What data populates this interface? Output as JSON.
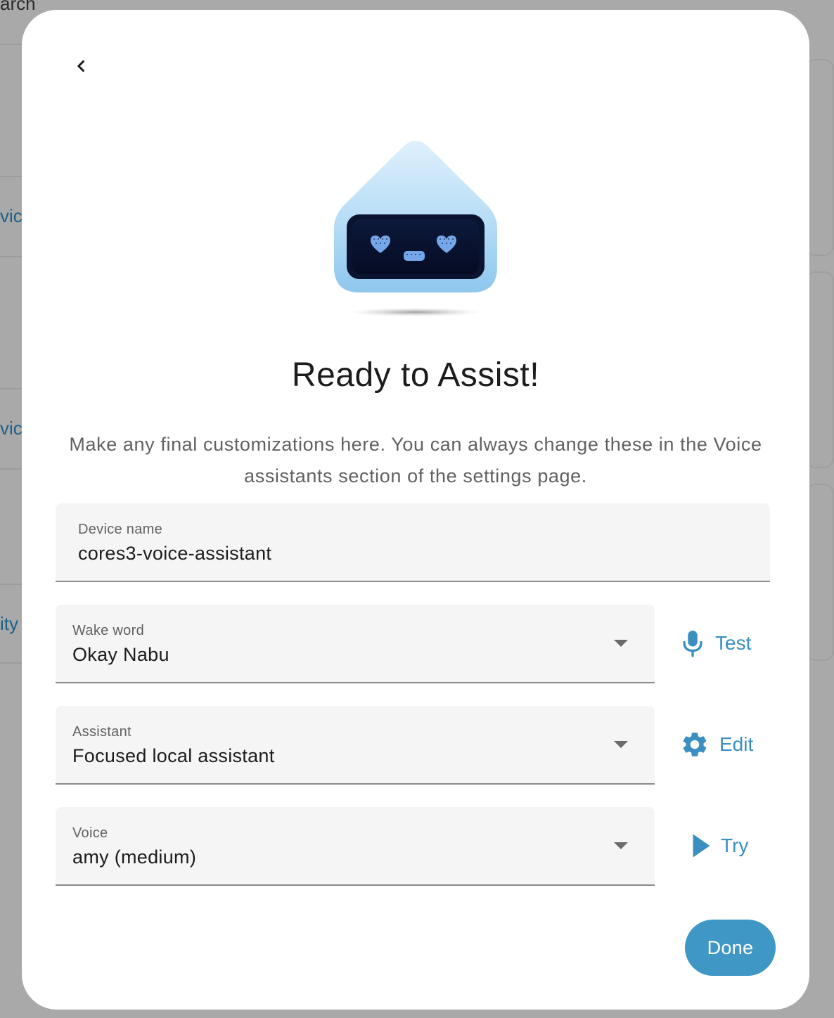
{
  "background": {
    "search_fragment": "arch",
    "fragments": [
      "vic",
      "vic",
      "ity"
    ]
  },
  "dialog": {
    "title": "Ready to Assist!",
    "subtitle": "Make any final customizations here. You can always change these in the Voice assistants section of the settings page.",
    "hero_icon": "voice-assistant-robot",
    "back_icon": "chevron-left",
    "device_name": {
      "label": "Device name",
      "value": "cores3-voice-assistant"
    },
    "wake_word": {
      "label": "Wake word",
      "value": "Okay Nabu",
      "action_label": "Test",
      "action_icon": "microphone"
    },
    "assistant": {
      "label": "Assistant",
      "value": "Focused local assistant",
      "action_label": "Edit",
      "action_icon": "gear"
    },
    "voice": {
      "label": "Voice",
      "value": "amy (medium)",
      "action_label": "Try",
      "action_icon": "play"
    },
    "done_label": "Done"
  },
  "colors": {
    "accent": "#3b8fc0",
    "primary_button": "#3f97c6",
    "field_background": "#f5f5f5",
    "scrim": "#a9a9a9"
  }
}
